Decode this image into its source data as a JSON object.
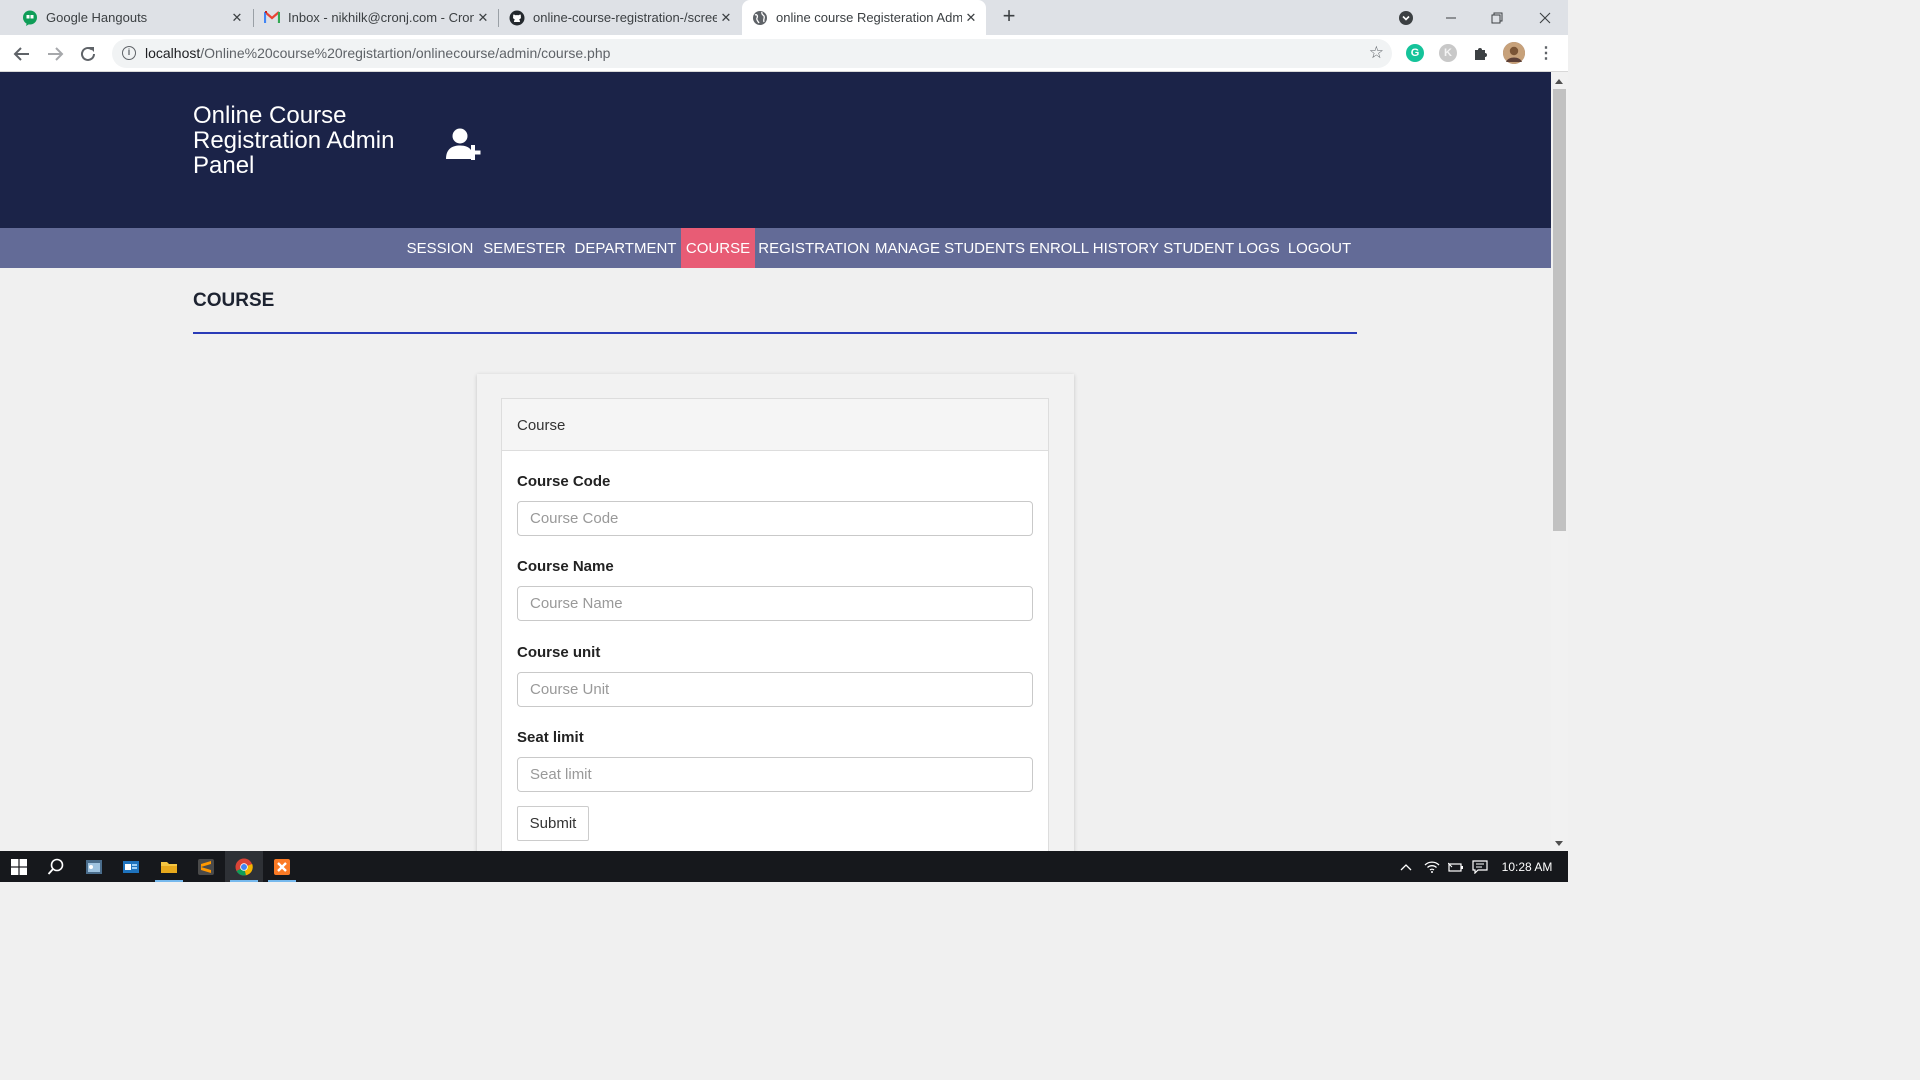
{
  "browser": {
    "tabs": [
      {
        "title": "Google Hangouts",
        "icon": "hangouts-icon"
      },
      {
        "title": "Inbox - nikhilk@cronj.com - Cron",
        "icon": "gmail-icon"
      },
      {
        "title": "online-course-registration-/scree",
        "icon": "github-icon"
      },
      {
        "title": "online course Registeration Admi",
        "icon": "globe-icon"
      }
    ],
    "new_tab": "+",
    "url_host": "localhost",
    "url_path": "/Online%20course%20registartion/onlinecourse/admin/course.php"
  },
  "site": {
    "title": "Online Course Registration Admin Panel",
    "colors": {
      "header": "#1b2348",
      "nav": "#636b97",
      "nav_active": "#e85c75",
      "rule": "#2a3bb7"
    }
  },
  "nav": {
    "items": [
      {
        "label": "SESSION"
      },
      {
        "label": "SEMESTER"
      },
      {
        "label": "DEPARTMENT"
      },
      {
        "label": "COURSE"
      },
      {
        "label": "REGISTRATION"
      },
      {
        "label": "MANAGE STUDENTS"
      },
      {
        "label": "ENROLL HISTORY"
      },
      {
        "label": "STUDENT LOGS"
      },
      {
        "label": "LOGOUT"
      }
    ],
    "active": "COURSE"
  },
  "page": {
    "heading": "COURSE"
  },
  "form": {
    "panel_title": "Course",
    "fields": [
      {
        "label": "Course Code",
        "placeholder": "Course Code",
        "value": ""
      },
      {
        "label": "Course Name",
        "placeholder": "Course Name",
        "value": ""
      },
      {
        "label": "Course unit",
        "placeholder": "Course Unit",
        "value": ""
      },
      {
        "label": "Seat limit",
        "placeholder": "Seat limit",
        "value": ""
      }
    ],
    "submit_label": "Submit"
  },
  "taskbar": {
    "clock": "10:28 AM"
  }
}
